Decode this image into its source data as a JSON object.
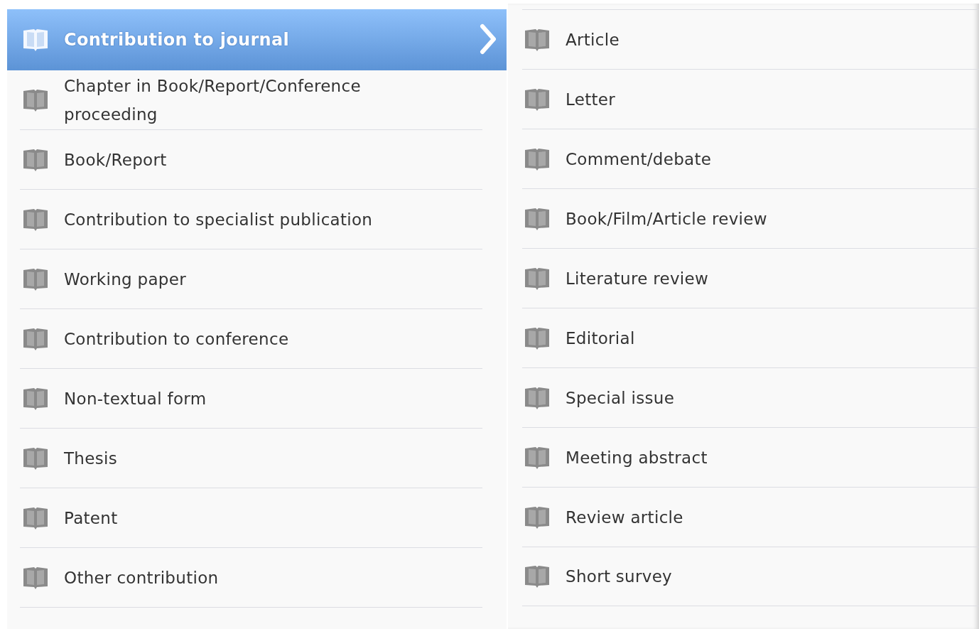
{
  "categories": [
    {
      "label": "Contribution to journal",
      "selected": true
    },
    {
      "label": "Chapter in Book/Report/Conference proceeding",
      "selected": false
    },
    {
      "label": "Book/Report",
      "selected": false
    },
    {
      "label": "Contribution to specialist publication",
      "selected": false
    },
    {
      "label": "Working paper",
      "selected": false
    },
    {
      "label": "Contribution to conference",
      "selected": false
    },
    {
      "label": "Non-textual form",
      "selected": false
    },
    {
      "label": "Thesis",
      "selected": false
    },
    {
      "label": "Patent",
      "selected": false
    },
    {
      "label": "Other contribution",
      "selected": false
    }
  ],
  "subtypes": [
    {
      "label": "Article"
    },
    {
      "label": "Letter"
    },
    {
      "label": "Comment/debate"
    },
    {
      "label": "Book/Film/Article review"
    },
    {
      "label": "Literature review"
    },
    {
      "label": "Editorial"
    },
    {
      "label": "Special issue"
    },
    {
      "label": "Meeting abstract"
    },
    {
      "label": "Review article"
    },
    {
      "label": "Short survey"
    }
  ]
}
